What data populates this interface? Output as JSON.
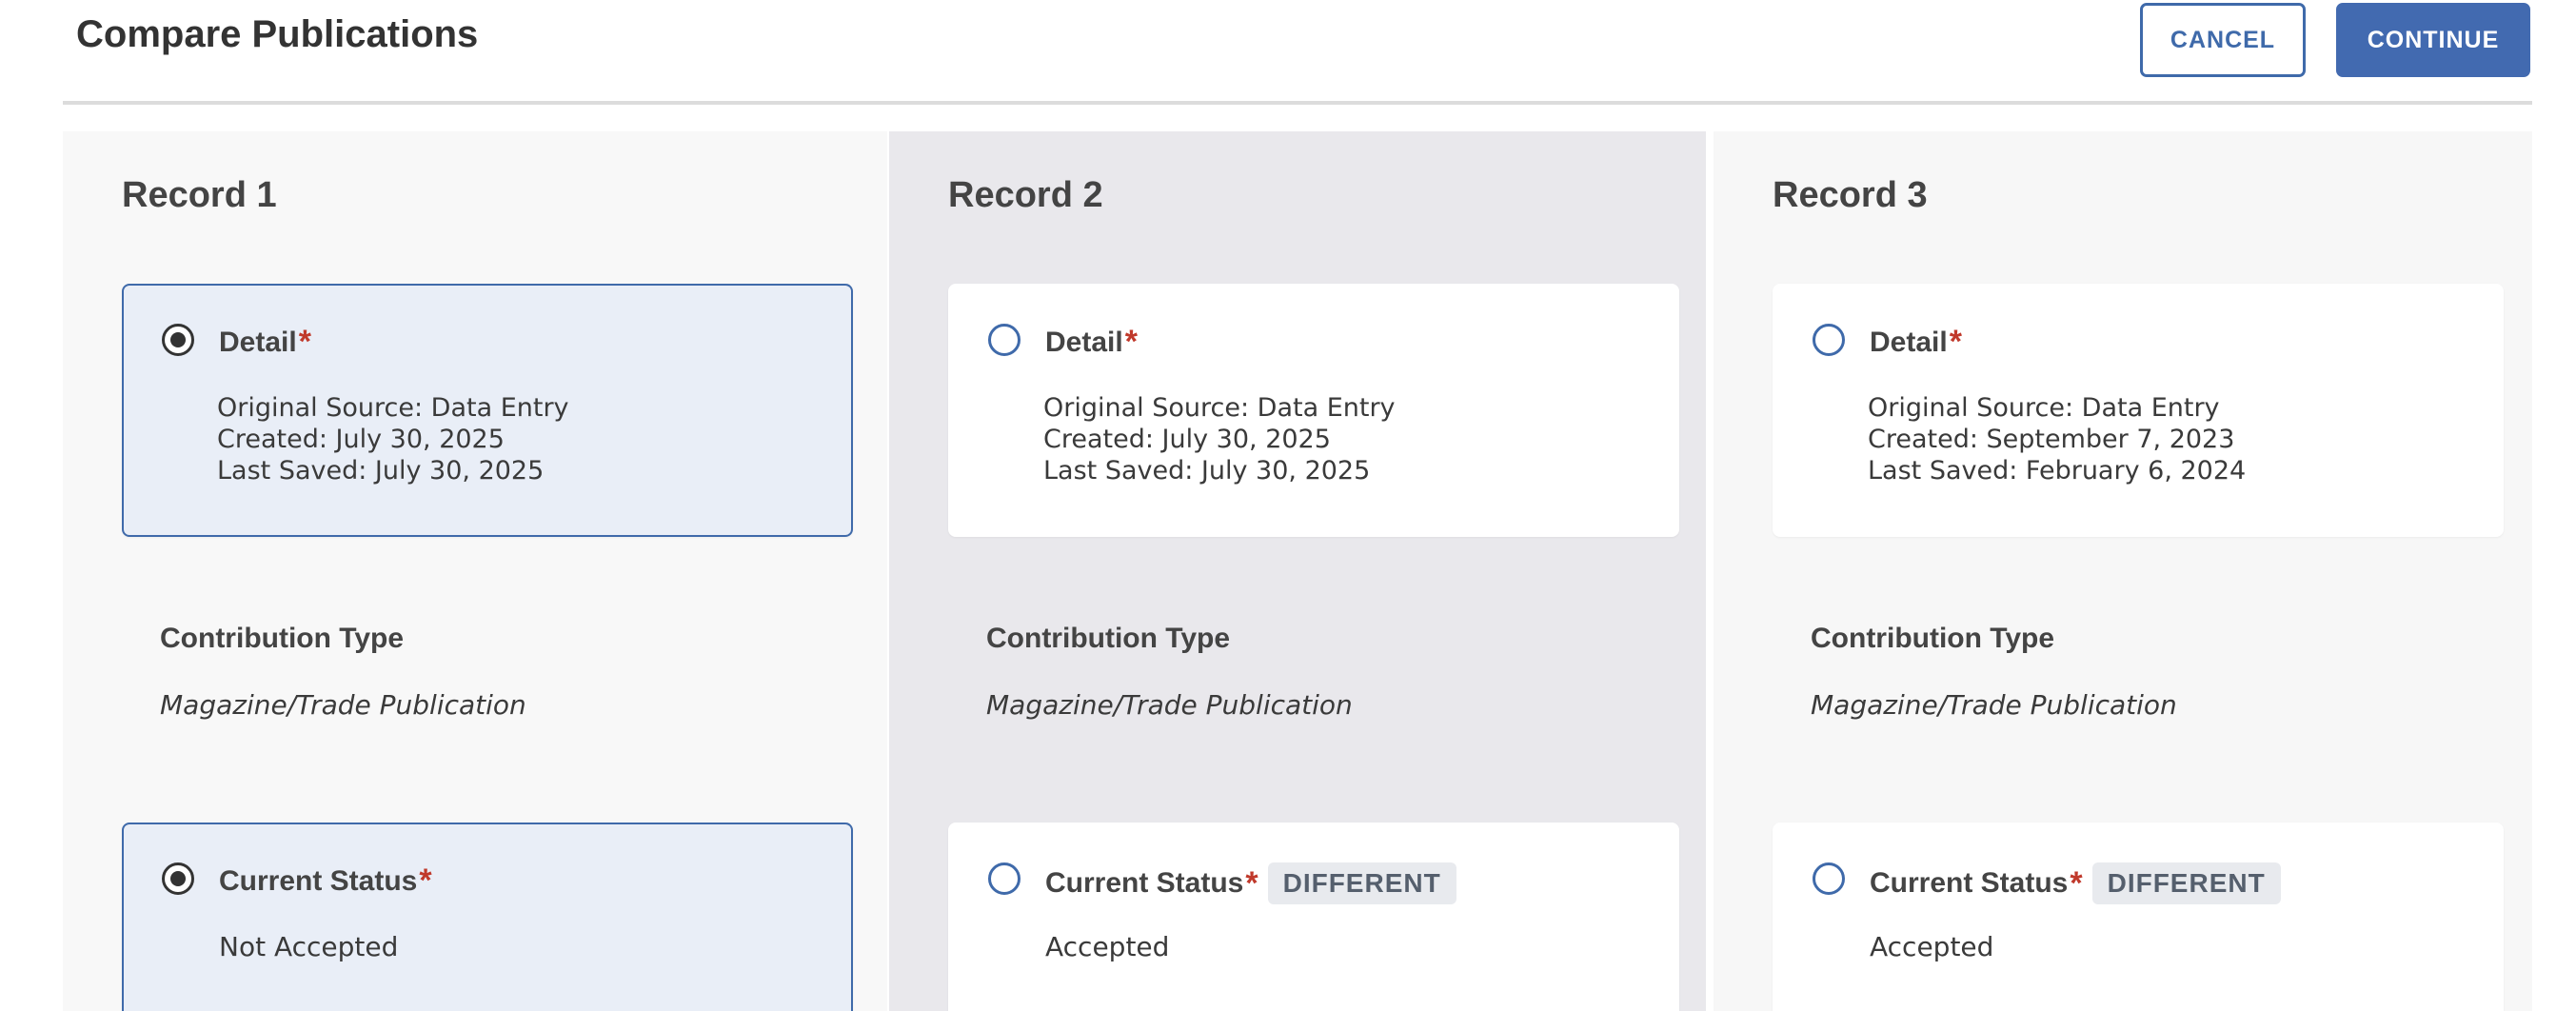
{
  "header": {
    "title": "Compare Publications",
    "cancel_label": "CANCEL",
    "continue_label": "CONTINUE"
  },
  "colors": {
    "accent": "#3f6aaa",
    "primary_button": "#426ab0",
    "required_asterisk": "#c0392b",
    "selected_card_bg": "#e9eef7"
  },
  "records": [
    {
      "title": "Record 1",
      "detail": {
        "label": "Detail",
        "required_mark": "*",
        "selected": true,
        "original_source": "Original Source: Data Entry",
        "created": "Created: July 30, 2025",
        "last_saved": "Last Saved: July 30, 2025"
      },
      "contribution_type": {
        "label": "Contribution Type",
        "value": "Magazine/Trade Publication"
      },
      "current_status": {
        "label": "Current Status",
        "required_mark": "*",
        "selected": true,
        "badge": "",
        "value": "Not Accepted"
      }
    },
    {
      "title": "Record 2",
      "detail": {
        "label": "Detail",
        "required_mark": "*",
        "selected": false,
        "original_source": "Original Source: Data Entry",
        "created": "Created: July 30, 2025",
        "last_saved": "Last Saved: July 30, 2025"
      },
      "contribution_type": {
        "label": "Contribution Type",
        "value": "Magazine/Trade Publication"
      },
      "current_status": {
        "label": "Current Status",
        "required_mark": "*",
        "selected": false,
        "badge": "DIFFERENT",
        "value": "Accepted"
      }
    },
    {
      "title": "Record 3",
      "detail": {
        "label": "Detail",
        "required_mark": "*",
        "selected": false,
        "original_source": "Original Source: Data Entry",
        "created": "Created: September 7, 2023",
        "last_saved": "Last Saved: February 6, 2024"
      },
      "contribution_type": {
        "label": "Contribution Type",
        "value": "Magazine/Trade Publication"
      },
      "current_status": {
        "label": "Current Status",
        "required_mark": "*",
        "selected": false,
        "badge": "DIFFERENT",
        "value": "Accepted"
      }
    }
  ]
}
